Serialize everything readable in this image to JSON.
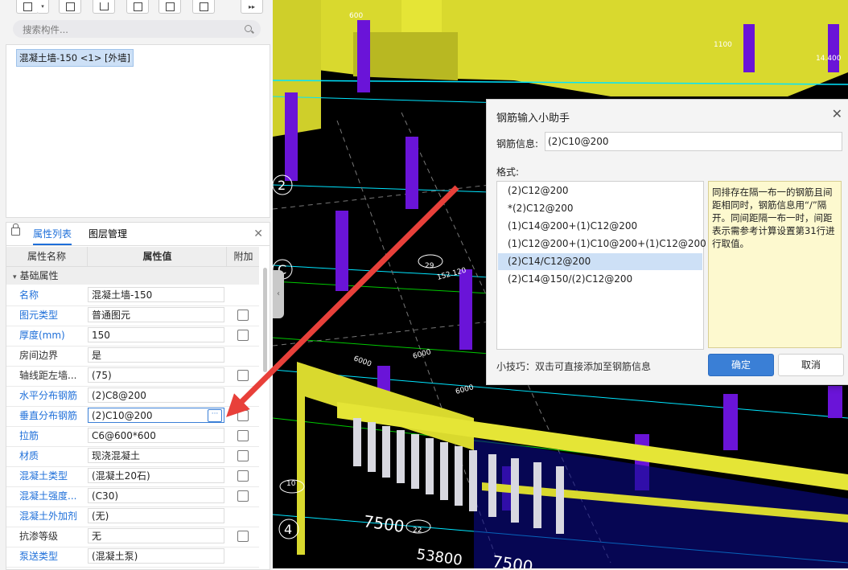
{
  "left_panel": {
    "search": {
      "placeholder": "搜索构件..."
    },
    "component_list": [
      "混凝土墙-150 <1> [外墙]"
    ],
    "tabs": [
      "属性列表",
      "图层管理"
    ],
    "grid_headers": {
      "name": "属性名称",
      "value": "属性值",
      "extra": "附加"
    },
    "group_label": "基础属性",
    "properties": [
      {
        "name": "名称",
        "value": "混凝土墙-150",
        "blue": true,
        "checkbox": false
      },
      {
        "name": "图元类型",
        "value": "普通图元",
        "blue": true,
        "checkbox": true
      },
      {
        "name": "厚度(mm)",
        "value": "150",
        "blue": true,
        "checkbox": true
      },
      {
        "name": "房间边界",
        "value": "是",
        "blue": false,
        "checkbox": false
      },
      {
        "name": "轴线距左墙...",
        "value": "(75)",
        "blue": false,
        "checkbox": true
      },
      {
        "name": "水平分布钢筋",
        "value": "(2)C8@200",
        "blue": true,
        "checkbox": false
      },
      {
        "name": "垂直分布钢筋",
        "value": "(2)C10@200",
        "blue": true,
        "checkbox": true,
        "editing": true
      },
      {
        "name": "拉筋",
        "value": "C6@600*600",
        "blue": true,
        "checkbox": true
      },
      {
        "name": "材质",
        "value": "现浇混凝土",
        "blue": true,
        "checkbox": true
      },
      {
        "name": "混凝土类型",
        "value": "(混凝土20石)",
        "blue": true,
        "checkbox": true
      },
      {
        "name": "混凝土强度...",
        "value": "(C30)",
        "blue": true,
        "checkbox": true
      },
      {
        "name": "混凝土外加剂",
        "value": "(无)",
        "blue": true,
        "checkbox": false
      },
      {
        "name": "抗渗等级",
        "value": "无",
        "blue": false,
        "checkbox": true
      },
      {
        "name": "泵送类型",
        "value": "(混凝土泵)",
        "blue": true,
        "checkbox": false
      }
    ]
  },
  "dialog": {
    "title": "钢筋输入小助手",
    "info_label": "钢筋信息:",
    "info_value": "(2)C10@200",
    "format_label": "格式:",
    "formats": [
      "(2)C12@200",
      "*(2)C12@200",
      "(1)C14@200+(1)C12@200",
      "(1)C12@200+(1)C10@200+(1)C12@200",
      "(2)C14/C12@200",
      "(2)C14@150/(2)C12@200"
    ],
    "selected_index": 4,
    "tip": "同排存在隔一布一的钢筋且间距相同时，钢筋信息用“/”隔开。同间距隔一布一时，间距表示需参考计算设置第31行进行取值。",
    "hint": "小技巧：双击可直接添加至钢筋信息",
    "ok_label": "确定",
    "cancel_label": "取消"
  },
  "viewport_labels": {
    "axis_2": "2",
    "axis_c": "C",
    "axis_4": "4",
    "dim_7500_a": "7500",
    "dim_7500_b": "7500",
    "dim_53800": "53800",
    "dim_6000_a": "6000",
    "dim_6000_b": "6000",
    "dim_6000_c": "6000",
    "elev_14400": "14.400",
    "tag_600": "600",
    "tag_1100": "1100",
    "tag_29": "29",
    "tag_22": "22",
    "tag_10": "10",
    "tag_152": "152.120"
  },
  "colors": {
    "accent": "#1e6fd9",
    "viewport_bg": "#000000",
    "wall_yellow": "#e5e536",
    "column_purple": "#6a14d8",
    "arrow_red": "#e8403a",
    "tip_bg": "#fdf9cf",
    "selected_row": "#cde0f6"
  },
  "icons": [
    "add-icon",
    "dropdown-icon",
    "copy-icon",
    "delete-icon",
    "layer-icon",
    "import-icon",
    "export-icon",
    "more-icon",
    "search-icon",
    "lock-icon",
    "close-icon",
    "ellipsis-icon",
    "collapse-arrow-icon"
  ]
}
